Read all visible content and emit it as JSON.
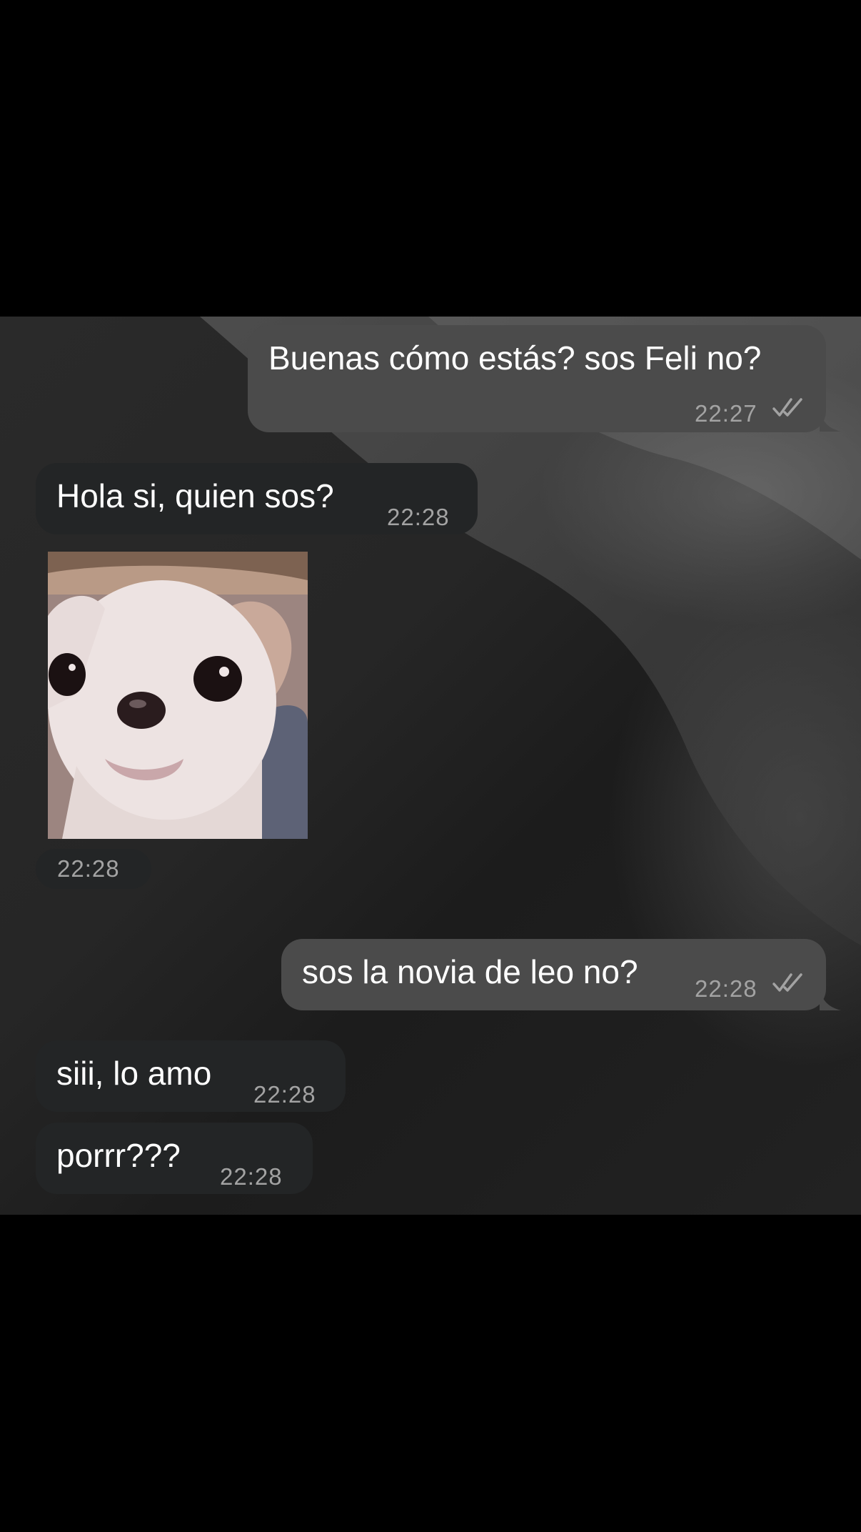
{
  "conversation": {
    "messages": [
      {
        "direction": "outgoing",
        "text": "Buenas cómo estás? sos Feli no?",
        "time": "22:27",
        "status_icon": "double-check-icon"
      },
      {
        "direction": "incoming",
        "text": "Hola si, quien sos?",
        "time": "22:28"
      },
      {
        "direction": "incoming",
        "type": "sticker",
        "sticker": "chihuahua-sticker",
        "time": "22:28"
      },
      {
        "direction": "outgoing",
        "text": "sos la novia de leo no?",
        "time": "22:28",
        "status_icon": "double-check-icon"
      },
      {
        "direction": "incoming",
        "text": "siii, lo amo",
        "time": "22:28"
      },
      {
        "direction": "incoming",
        "text": "porrr???",
        "time": "22:28"
      }
    ]
  },
  "colors": {
    "outgoing_bubble": "#4b4b4b",
    "incoming_bubble": "#232526",
    "timestamp": "#a3a3a3",
    "letterbox": "#000000"
  }
}
